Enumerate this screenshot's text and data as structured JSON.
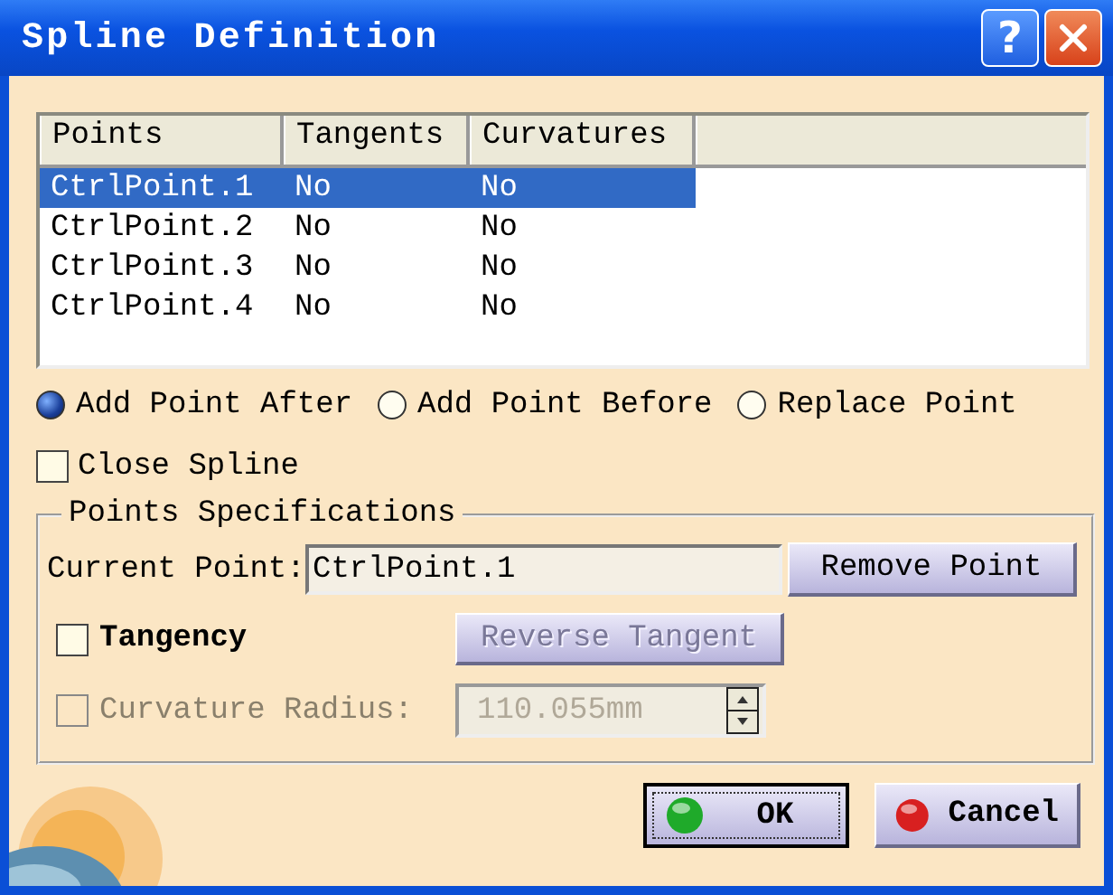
{
  "window": {
    "title": "Spline Definition",
    "help_button": "?"
  },
  "table": {
    "columns": [
      "Points",
      "Tangents",
      "Curvatures"
    ],
    "rows": [
      {
        "cells": [
          "CtrlPoint.1",
          "No",
          "No"
        ],
        "selected": true
      },
      {
        "cells": [
          "CtrlPoint.2",
          "No",
          "No"
        ],
        "selected": false
      },
      {
        "cells": [
          "CtrlPoint.3",
          "No",
          "No"
        ],
        "selected": false
      },
      {
        "cells": [
          "CtrlPoint.4",
          "No",
          "No"
        ],
        "selected": false
      }
    ]
  },
  "insert_options": [
    {
      "label": "Add Point After",
      "selected": true
    },
    {
      "label": "Add Point Before",
      "selected": false
    },
    {
      "label": "Replace Point",
      "selected": false
    }
  ],
  "close_spline": {
    "label": "Close Spline",
    "checked": false
  },
  "points_specifications": {
    "title": "Points Specifications",
    "current_point": {
      "label": "Current Point:",
      "value": "CtrlPoint.1"
    },
    "remove_button": {
      "label": "Remove Point",
      "disabled": false
    },
    "tangency": {
      "label": "Tangency",
      "checked": false,
      "disabled": false
    },
    "reverse_button": {
      "label": "Reverse Tangent",
      "disabled": true
    },
    "curvature_radius": {
      "label": "Curvature Radius:",
      "value": "110.055mm",
      "checked": false,
      "disabled": true
    }
  },
  "buttons": [
    {
      "label": "OK",
      "kind": "ok"
    },
    {
      "label": "Cancel",
      "kind": "cancel"
    }
  ]
}
